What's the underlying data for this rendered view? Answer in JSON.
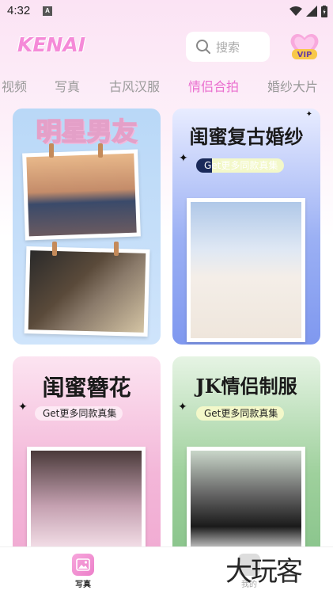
{
  "status": {
    "time": "4:32",
    "notif_letter": "A"
  },
  "header": {
    "logo": "KENAI",
    "search_placeholder": "搜索",
    "vip_label": "VIP"
  },
  "tabs": [
    {
      "label": "视频",
      "active": false
    },
    {
      "label": "写真",
      "active": false
    },
    {
      "label": "古风汉服",
      "active": false
    },
    {
      "label": "情侣合拍",
      "active": true
    },
    {
      "label": "婚纱大片",
      "active": false
    }
  ],
  "cards": [
    {
      "title": "明星男友",
      "get_label": ""
    },
    {
      "title": "闺蜜复古婚纱",
      "get_label": "Get更多同款真集"
    },
    {
      "title": "闺蜜簪花",
      "get_label": "Get更多同款真集"
    },
    {
      "title": "JK情侣制服",
      "get_label": "Get更多同款真集"
    }
  ],
  "bottom_nav": [
    {
      "label": "写真",
      "icon": "photo-icon",
      "active": true
    },
    {
      "label": "我的",
      "icon": "profile-icon",
      "active": false
    }
  ],
  "watermark": "大玩客",
  "colors": {
    "accent": "#ea6fcf",
    "tab_inactive": "#9a9a9a",
    "pill": "#f3f8c9"
  }
}
